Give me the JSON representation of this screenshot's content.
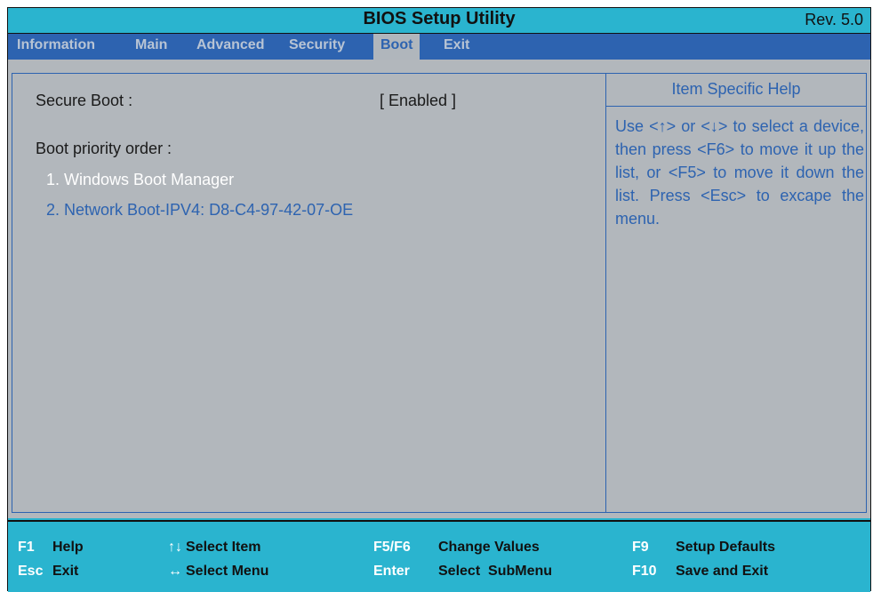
{
  "title": "BIOS Setup Utility",
  "revision": "Rev. 5.0",
  "menu": [
    "Information",
    "Main",
    "Advanced",
    "Security",
    "Boot",
    "Exit"
  ],
  "active_tab": "Boot",
  "settings": {
    "secure_boot_label": "Secure Boot :",
    "secure_boot_value": "[ Enabled ]",
    "boot_priority_label": "Boot priority order :",
    "boot_items": [
      "1. Windows Boot Manager",
      "2. Network Boot-IPV4: D8-C4-97-42-07-OE"
    ]
  },
  "help": {
    "header": "Item Specific Help",
    "text": "Use <↑> or <↓> to select a device, then press <F6> to move it up the list, or <F5> to move it down the list. Press <Esc> to excape the menu."
  },
  "footer": {
    "row1": [
      {
        "key": "F1",
        "desc": "Help"
      },
      {
        "key": "↑↓",
        "desc": "Select Item"
      },
      {
        "key": "F5/F6",
        "desc": "Change Values"
      },
      {
        "key": "F9",
        "desc": "Setup Defaults"
      }
    ],
    "row2": [
      {
        "key": "Esc",
        "desc": "Exit"
      },
      {
        "key": "↔",
        "desc": "Select Menu"
      },
      {
        "key": "Enter",
        "desc": "Select  SubMenu"
      },
      {
        "key": "F10",
        "desc": "Save and Exit"
      }
    ]
  },
  "colors": {
    "cyan": "#2ab4cf",
    "blue": "#2d63b0",
    "panel_gray": "#b2b7bc"
  }
}
